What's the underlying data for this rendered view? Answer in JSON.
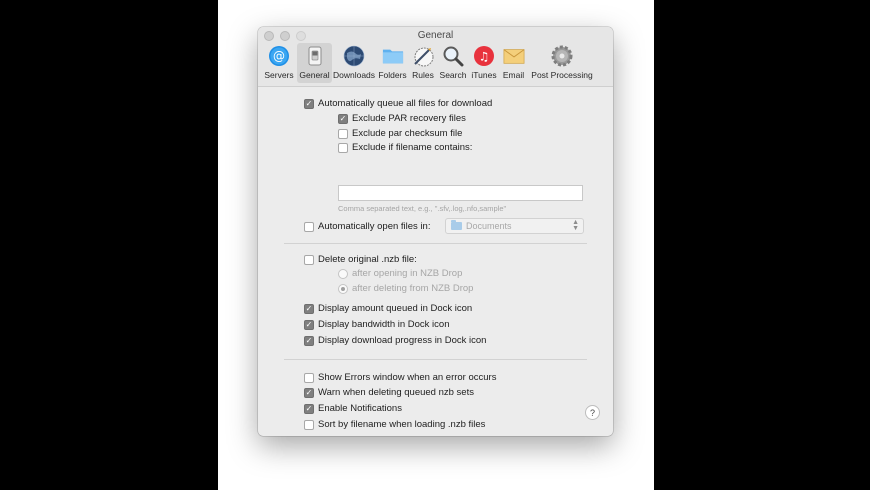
{
  "window": {
    "title": "General"
  },
  "toolbar": {
    "items": [
      {
        "label": "Servers",
        "icon": "at-sign-icon"
      },
      {
        "label": "General",
        "icon": "switch-icon",
        "selected": true
      },
      {
        "label": "Downloads",
        "icon": "globe-icon"
      },
      {
        "label": "Folders",
        "icon": "folder-icon"
      },
      {
        "label": "Rules",
        "icon": "rules-icon"
      },
      {
        "label": "Search",
        "icon": "magnifier-icon"
      },
      {
        "label": "iTunes",
        "icon": "itunes-icon"
      },
      {
        "label": "Email",
        "icon": "envelope-icon"
      },
      {
        "label": "Post Processing",
        "icon": "gear-icon"
      }
    ]
  },
  "options": {
    "auto_queue": {
      "label": "Automatically queue all files for download",
      "checked": true
    },
    "exclude_par": {
      "label": "Exclude PAR recovery files",
      "checked": true
    },
    "exclude_checksum": {
      "label": "Exclude par checksum file",
      "checked": false
    },
    "exclude_filename": {
      "label": "Exclude if filename contains:",
      "checked": false
    },
    "exclude_text": {
      "value": "",
      "hint": "Comma separated text, e.g., \".sfv,.log,.nfo,sample\""
    },
    "auto_open": {
      "label": "Automatically open files in:",
      "checked": false,
      "folder": "Documents"
    },
    "delete_nzb": {
      "label": "Delete original .nzb file:",
      "checked": false
    },
    "delete_after_opening": {
      "label": "after opening in NZB Drop",
      "selected": false
    },
    "delete_after_deleting": {
      "label": "after deleting from NZB Drop",
      "selected": true
    },
    "dock_queued": {
      "label": "Display amount queued in Dock icon",
      "checked": true
    },
    "dock_bandwidth": {
      "label": "Display bandwidth in Dock icon",
      "checked": true
    },
    "dock_progress": {
      "label": "Display download progress in Dock icon",
      "checked": true
    },
    "show_errors": {
      "label": "Show Errors window when an error occurs",
      "checked": false
    },
    "warn_delete": {
      "label": "Warn when deleting queued nzb sets",
      "checked": true
    },
    "notifications": {
      "label": "Enable Notifications",
      "checked": true
    },
    "sort_filename": {
      "label": "Sort by filename when loading .nzb files",
      "checked": false
    }
  },
  "help": {
    "label": "?"
  },
  "colors": {
    "checked": "#7f7f7f",
    "window_bg": "#ececec"
  }
}
